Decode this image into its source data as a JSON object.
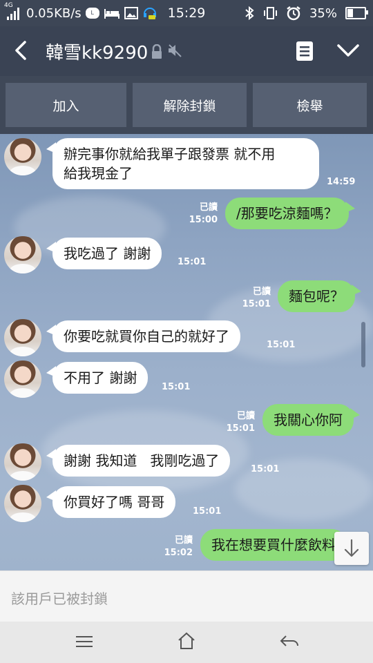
{
  "status_bar": {
    "network": "4G",
    "speed": "0.05KB/s",
    "time": "15:29",
    "battery": "35%",
    "battery_level": 0.35,
    "icons": [
      "signal-icon",
      "line-icon",
      "bed-icon",
      "gallery-icon",
      "headset-icon",
      "bluetooth-icon",
      "vibrate-icon",
      "alarm-icon",
      "battery-icon"
    ]
  },
  "header": {
    "title": "韓雪kk9290",
    "icons": [
      "back-icon",
      "lock-icon",
      "mute-icon",
      "note-icon",
      "chevron-down-icon"
    ]
  },
  "actions": {
    "add_label": "加入",
    "unblock_label": "解除封鎖",
    "report_label": "檢舉"
  },
  "messages": [
    {
      "side": "in",
      "lines": [
        "辦完事你就給我單子跟發票 就不用",
        "給我現金了"
      ],
      "time": "14:59"
    },
    {
      "side": "out",
      "text": "/那要吃涼麵嗎？",
      "read": "已讀",
      "time": "15:00"
    },
    {
      "side": "in",
      "text": "我吃過了 謝謝",
      "time": "15:01"
    },
    {
      "side": "out",
      "text": "麵包呢？",
      "read": "已讀",
      "time": "15:01"
    },
    {
      "side": "in",
      "text": "你要吃就買你自己的就好了",
      "time": "15:01"
    },
    {
      "side": "in",
      "text": "不用了 謝謝",
      "time": "15:01"
    },
    {
      "side": "out",
      "text": "我關心你阿",
      "read": "已讀",
      "time": "15:01"
    },
    {
      "side": "in",
      "text": "謝謝 我知道   我剛吃過了",
      "time": "15:01"
    },
    {
      "side": "in",
      "text": "你買好了嗎 哥哥",
      "time": "15:01"
    },
    {
      "side": "out",
      "text": "我在想要買什麼飲料",
      "read": "已讀",
      "time": "15:02"
    }
  ],
  "footer": {
    "blocked_text": "該用戶已被封鎖"
  },
  "colors": {
    "header": "#3a4354",
    "outgoing_bubble": "#8ddc79",
    "incoming_bubble": "#ffffff"
  }
}
